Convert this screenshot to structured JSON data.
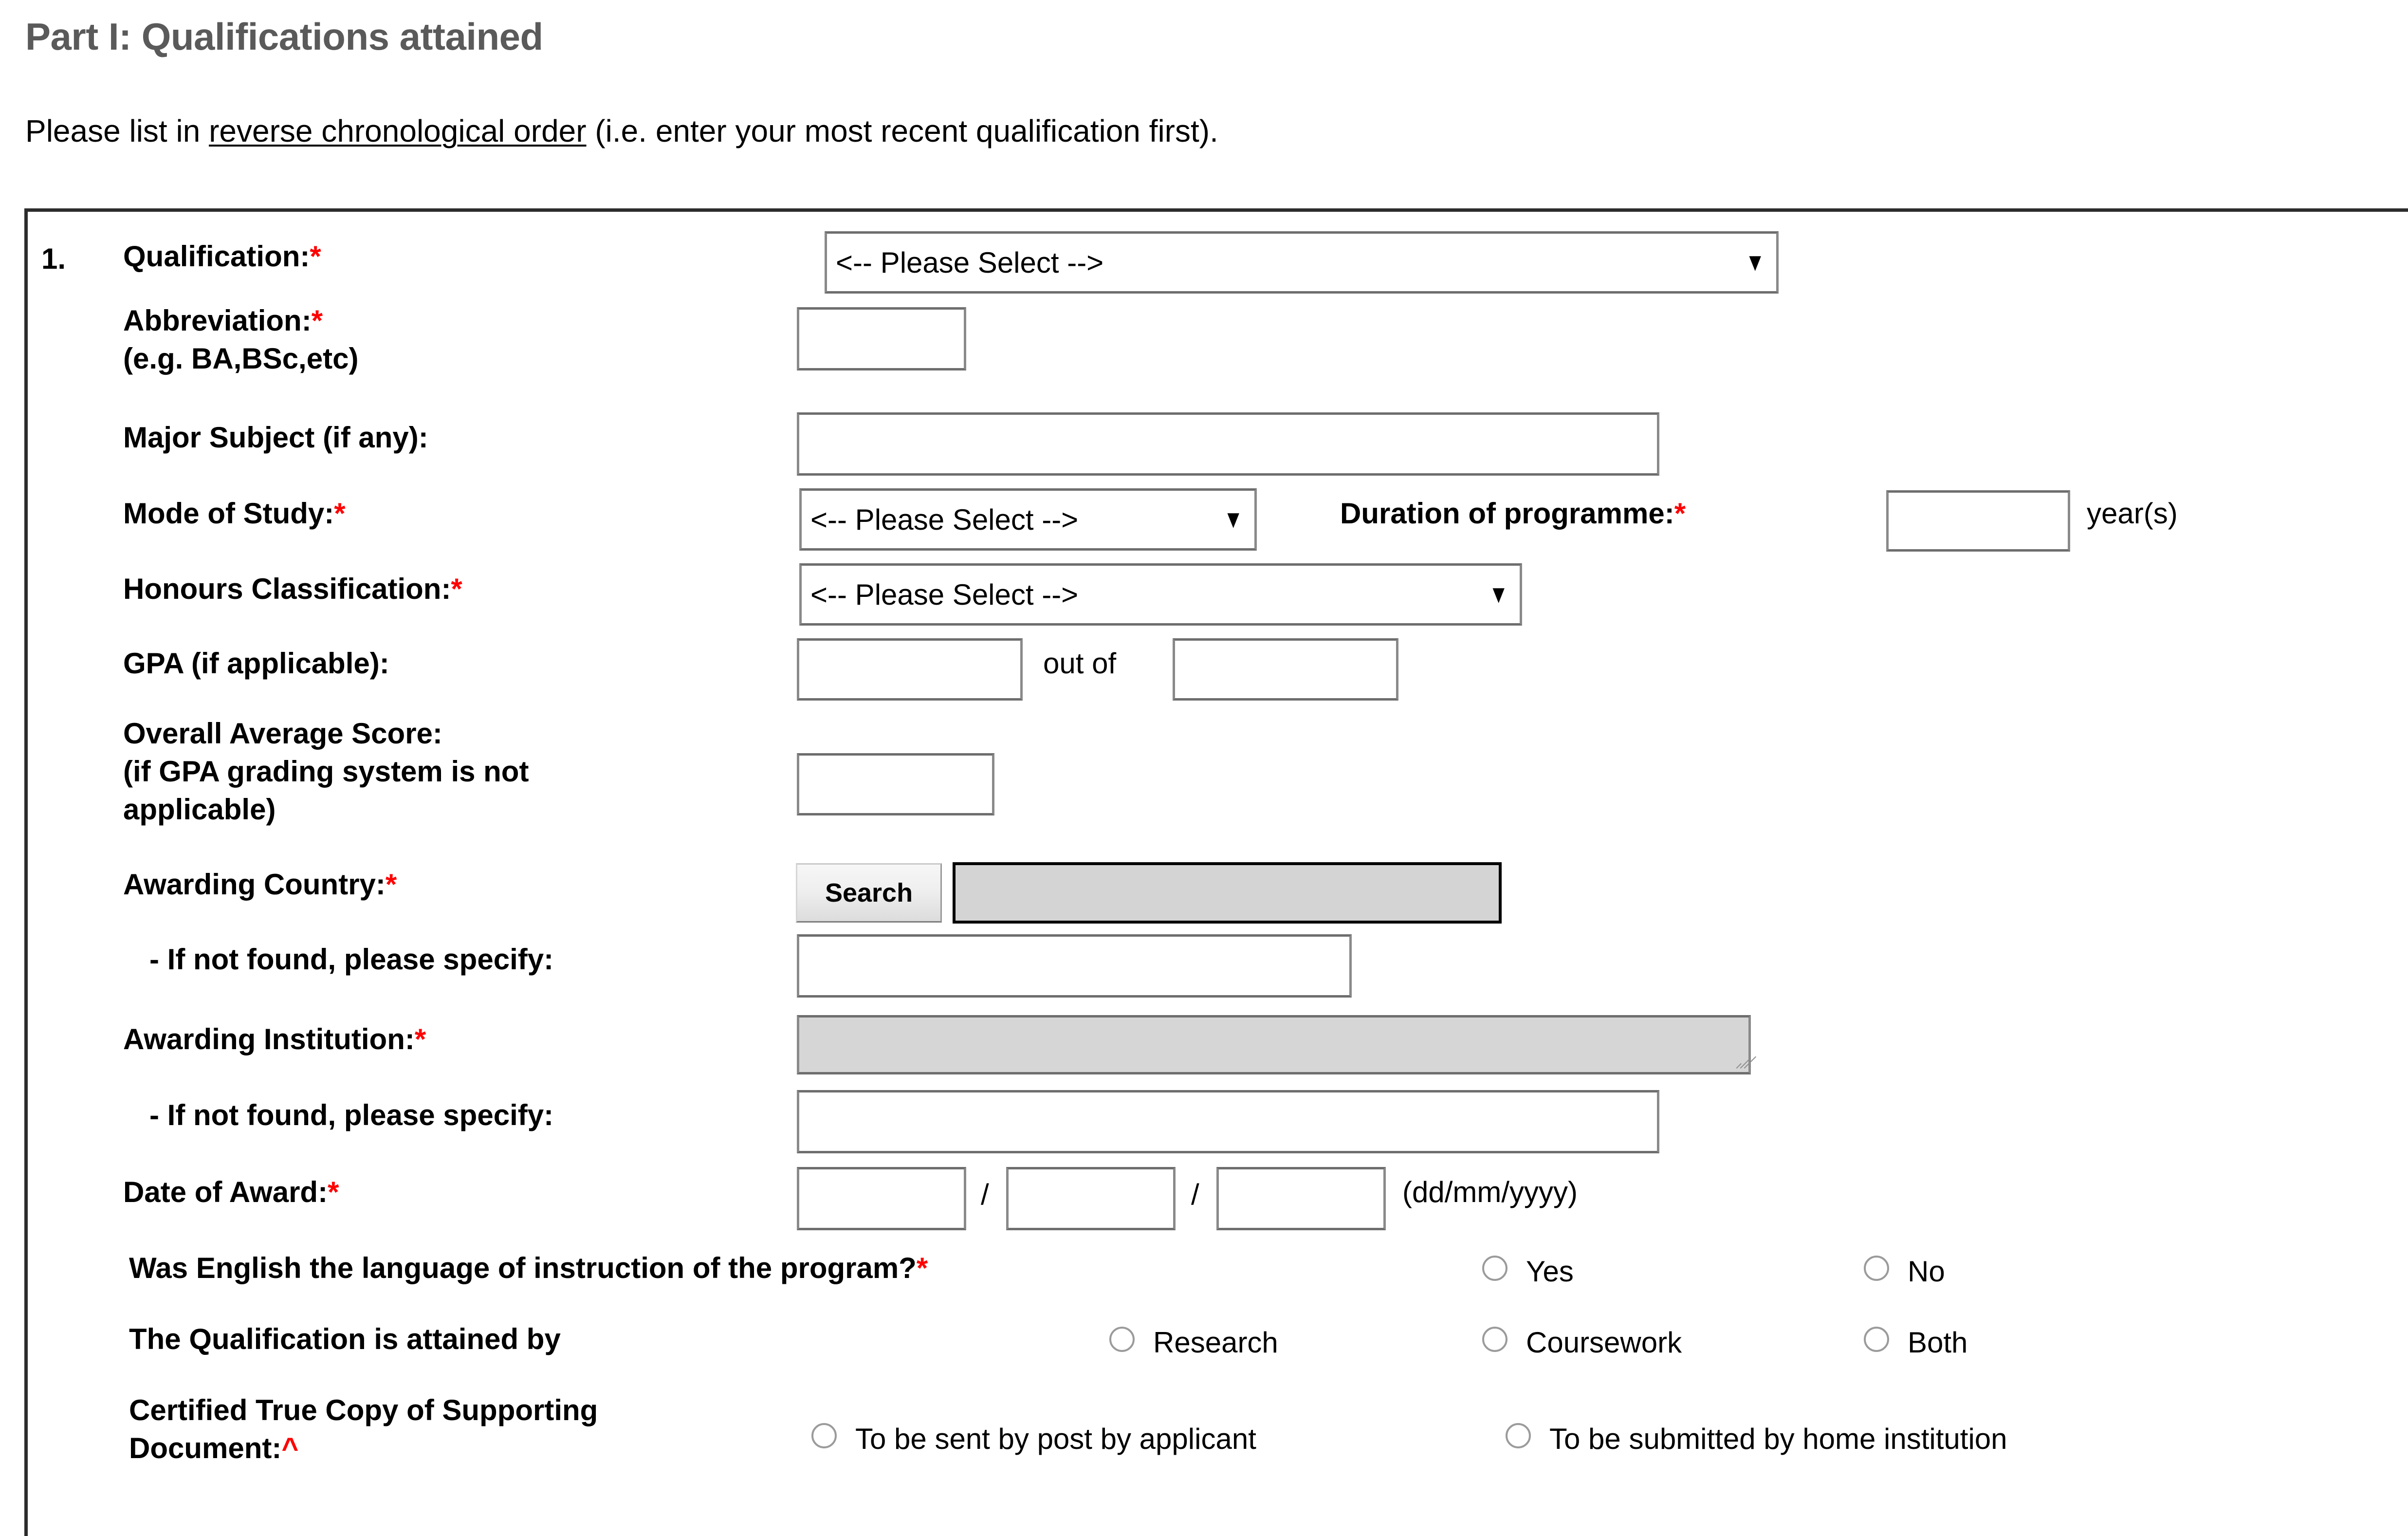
{
  "header": {
    "title": "Part I: Qualifications attained",
    "intro_before": "Please list in ",
    "intro_underlined": "reverse chronological order",
    "intro_after": " (i.e. enter your most recent qualification first)."
  },
  "entry": {
    "number": "1.",
    "qualification": {
      "label": "Qualification:",
      "required": "*",
      "select_value": "<-- Please Select -->"
    },
    "abbreviation": {
      "label": "Abbreviation:",
      "required": "*",
      "hint": "(e.g. BA,BSc,etc)",
      "value": ""
    },
    "major_subject": {
      "label": "Major Subject (if any):",
      "value": ""
    },
    "mode_of_study": {
      "label": "Mode of Study:",
      "required": "*",
      "select_value": "<-- Please Select -->"
    },
    "duration": {
      "label": "Duration of programme:",
      "required": "*",
      "value": "",
      "unit": "year(s)"
    },
    "honours_classification": {
      "label": "Honours Classification:",
      "required": "*",
      "select_value": "<-- Please Select -->"
    },
    "gpa": {
      "label": "GPA (if applicable):",
      "value": "",
      "out_of_label": "out of",
      "out_of_value": ""
    },
    "overall_average_score": {
      "label_line1": "Overall Average Score:",
      "label_line2": "(if GPA grading system is not",
      "label_line3": "applicable)",
      "value": ""
    },
    "awarding_country": {
      "label": "Awarding Country:",
      "required": "*",
      "search_button": "Search",
      "value": "",
      "not_found_label": "- If not found, please specify:",
      "not_found_value": ""
    },
    "awarding_institution": {
      "label": "Awarding Institution:",
      "required": "*",
      "value": "",
      "not_found_label": "- If not found, please specify:",
      "not_found_value": ""
    },
    "date_of_award": {
      "label": "Date of Award:",
      "required": "*",
      "day": "",
      "month": "",
      "year": "",
      "separator": "/",
      "format_hint": "(dd/mm/yyyy)"
    },
    "english_language": {
      "label": "Was English the language of instruction of the program?",
      "required": "*",
      "options": [
        "Yes",
        "No"
      ]
    },
    "attained_by": {
      "label": "The Qualification is attained by",
      "options": [
        "Research",
        "Coursework",
        "Both"
      ]
    },
    "certified_copy": {
      "label_line1": "Certified True Copy of Supporting",
      "label_line2": "Document:",
      "marker": "^",
      "options": [
        "To be sent by post by applicant",
        "To be submitted by home institution"
      ]
    }
  },
  "colors": {
    "required_star": "#ff0000",
    "title_grey": "#5a5a5a",
    "disabled_field": "#d4d4d4"
  }
}
